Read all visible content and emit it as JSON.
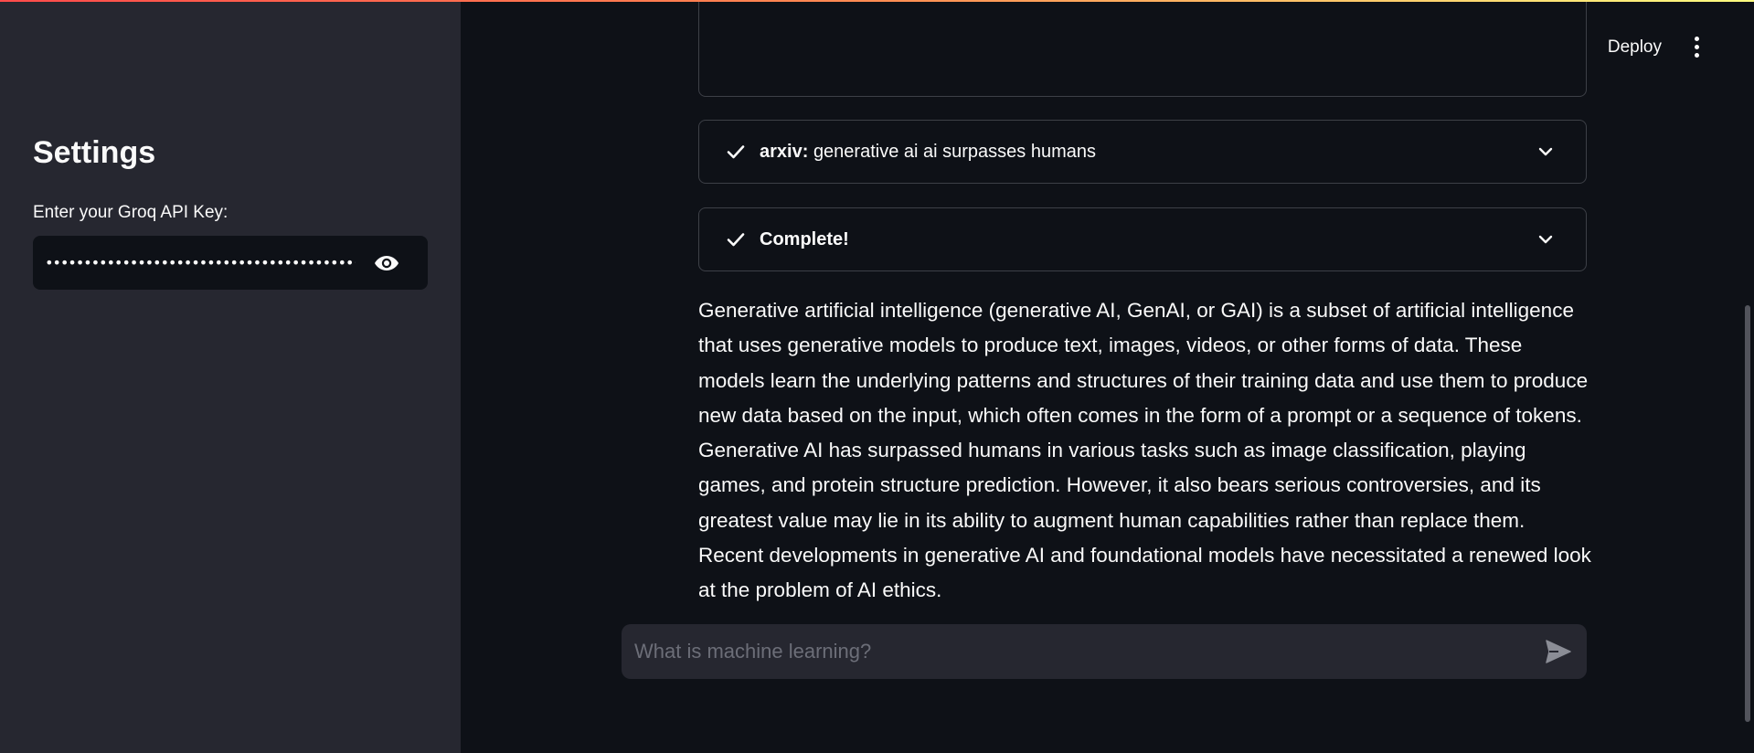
{
  "sidebar": {
    "title": "Settings",
    "api_key_label": "Enter your Groq API Key:",
    "api_key_masked": "••••••••••••••••••••••••••••••••••••••••••••••••••",
    "reveal_icon": "eye-icon"
  },
  "header": {
    "deploy_label": "Deploy",
    "menu_icon": "kebab-menu-icon"
  },
  "steps": [
    {
      "status_icon": "check-icon",
      "source": "arxiv:",
      "query": "generative ai ai surpasses humans"
    },
    {
      "status_icon": "check-icon",
      "label": "Complete!"
    }
  ],
  "answer": "Generative artificial intelligence (generative AI, GenAI, or GAI) is a subset of artificial intelligence that uses generative models to produce text, images, videos, or other forms of data. These models learn the underlying patterns and structures of their training data and use them to produce new data based on the input, which often comes in the form of a prompt or a sequence of tokens. Generative AI has surpassed humans in various tasks such as image classification, playing games, and protein structure prediction. However, it also bears serious controversies, and its greatest value may lie in its ability to augment human capabilities rather than replace them. Recent developments in generative AI and foundational models have necessitated a renewed look at the problem of AI ethics.",
  "chat": {
    "placeholder": "What is machine learning?",
    "send_icon": "send-icon"
  },
  "colors": {
    "accent_gradient_start": "#ff4b4b",
    "accent_gradient_end": "#fffd80",
    "sidebar_bg": "#262730",
    "main_bg": "#0e1117"
  }
}
